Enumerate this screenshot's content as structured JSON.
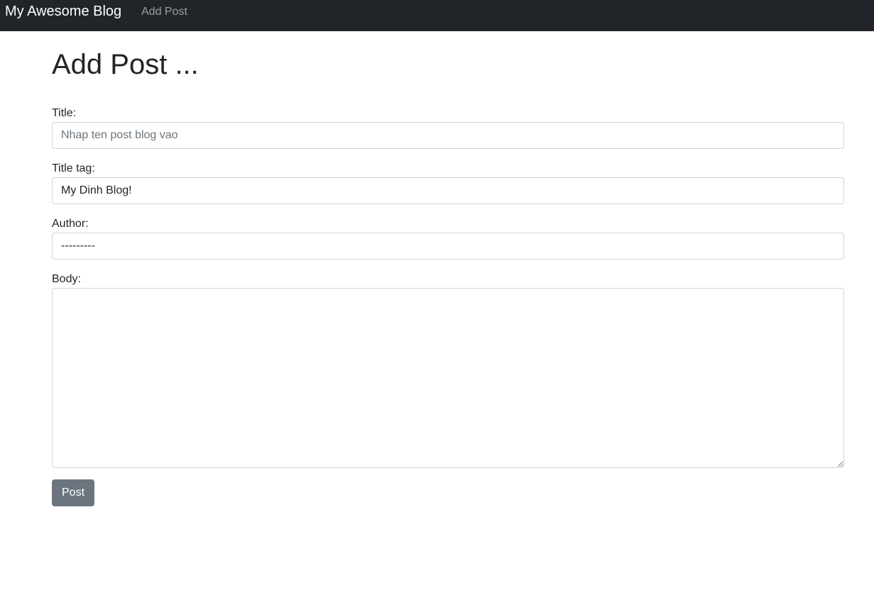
{
  "navbar": {
    "brand": "My Awesome Blog",
    "links": [
      {
        "label": "Add Post"
      }
    ]
  },
  "page": {
    "title": "Add Post ..."
  },
  "form": {
    "title": {
      "label": "Title:",
      "value": "",
      "placeholder": "Nhap ten post blog vao"
    },
    "title_tag": {
      "label": "Title tag:",
      "value": "My Dinh Blog!"
    },
    "author": {
      "label": "Author:",
      "selected": "---------"
    },
    "body": {
      "label": "Body:",
      "value": ""
    },
    "submit_label": "Post"
  },
  "colors": {
    "navbar_bg": "#212529",
    "button_bg": "#6c757d",
    "border": "#ced4da"
  }
}
